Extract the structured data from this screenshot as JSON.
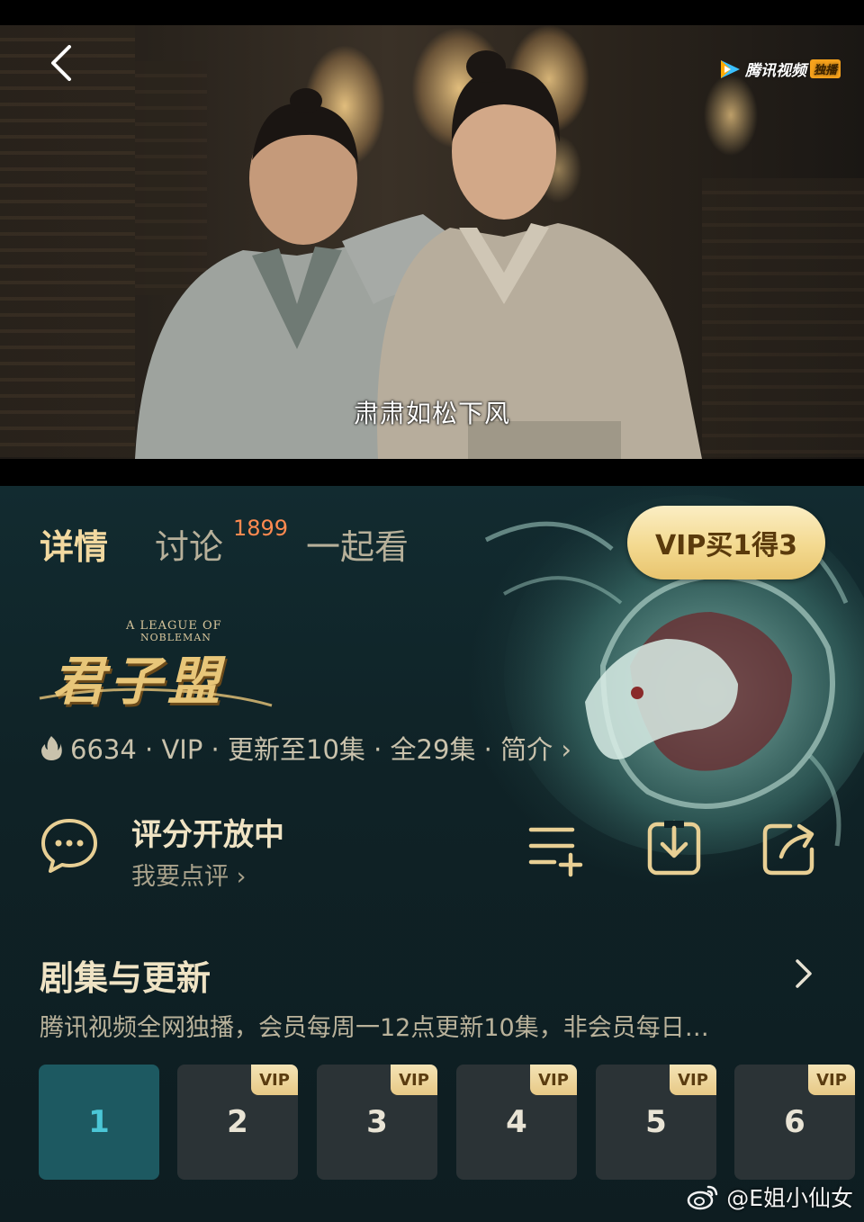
{
  "video": {
    "subtitle": "肃肃如松下风",
    "brand": "腾讯视频",
    "brand_tag": "独播"
  },
  "tabs": {
    "details": "详情",
    "discuss": "讨论",
    "discuss_count": "1899",
    "watch_together": "一起看"
  },
  "vip_button": "VIP买1得3",
  "show": {
    "logo_en_1": "A LEAGUE OF",
    "logo_en_2": "NOBLEMAN",
    "logo_cn": "君子盟",
    "meta": "6634 · VIP · 更新至10集 · 全29集 · 简介 ›"
  },
  "rating": {
    "title": "评分开放中",
    "subtitle": "我要点评 ›"
  },
  "episodes": {
    "header": "剧集与更新",
    "description": "腾讯视频全网独播，会员每周一12点更新10集，非会员每日…",
    "vip_label": "VIP",
    "list": [
      "1",
      "2",
      "3",
      "4",
      "5",
      "6"
    ]
  },
  "watermark": "@E姐小仙女",
  "colors": {
    "accent_gold": "#f2d9a0",
    "vip_gold": "#f3d98f",
    "panel_bg": "#122b30",
    "episode_active": "#1d5961",
    "episode_active_text": "#4bc6d6",
    "badge_orange": "#ff8a50"
  }
}
